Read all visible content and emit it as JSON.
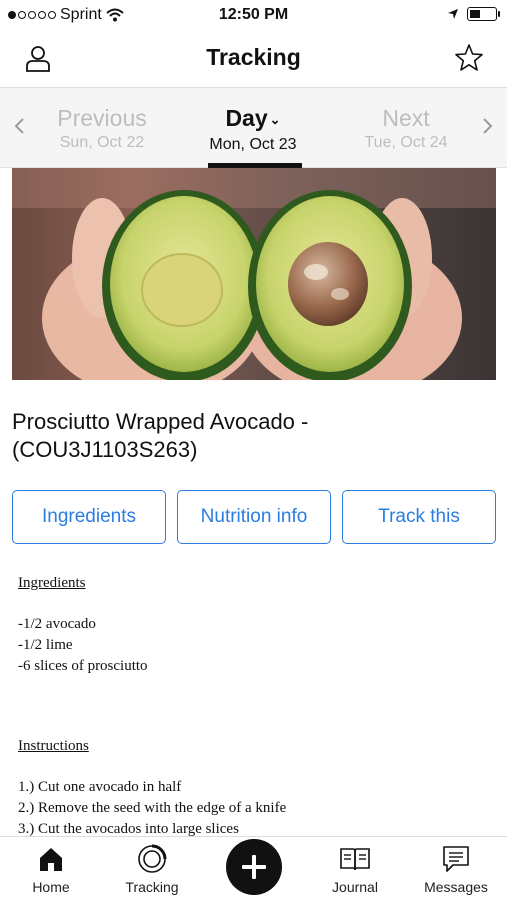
{
  "status_bar": {
    "carrier": "Sprint",
    "time": "12:50 PM",
    "signal_bars_filled": 1,
    "signal_bars_total": 5,
    "battery_level": 0.4
  },
  "header": {
    "title": "Tracking",
    "left_icon": "profile-icon",
    "right_icon": "star-icon"
  },
  "date_nav": {
    "previous": {
      "label": "Previous",
      "date": "Sun, Oct 22"
    },
    "current": {
      "label": "Day",
      "date": "Mon, Oct 23"
    },
    "next": {
      "label": "Next",
      "date": "Tue, Oct 24"
    }
  },
  "recipe": {
    "title": "Prosciutto Wrapped Avocado - (COU3J1103S263)"
  },
  "actions": {
    "ingredients": "Ingredients",
    "nutrition": "Nutrition info",
    "track": "Track this"
  },
  "content": {
    "ingredients_heading": "Ingredients",
    "ingredients": [
      "-1/2 avocado",
      "-1/2 lime",
      "-6 slices of prosciutto"
    ],
    "instructions_heading": "Instructions",
    "instructions": [
      "1.) Cut one avocado in half",
      "2.) Remove the seed with the edge of a knife",
      "3.) Cut the avocados into large slices"
    ]
  },
  "tab_bar": {
    "home": "Home",
    "tracking": "Tracking",
    "journal": "Journal",
    "messages": "Messages"
  },
  "colors": {
    "accent": "#2a7de1",
    "inactive_text": "#bdbdbd"
  }
}
